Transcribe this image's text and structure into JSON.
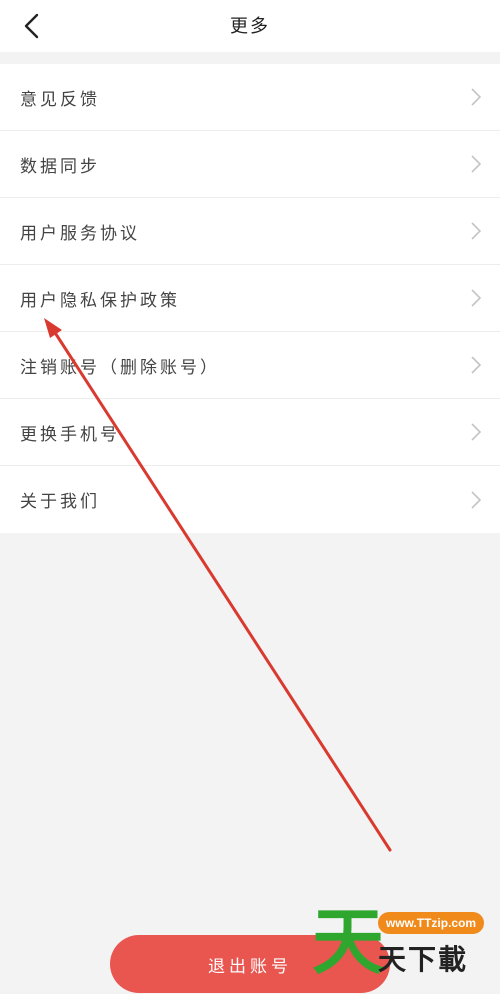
{
  "header": {
    "title": "更多"
  },
  "menu": {
    "items": [
      {
        "label": "意见反馈"
      },
      {
        "label": "数据同步"
      },
      {
        "label": "用户服务协议"
      },
      {
        "label": "用户隐私保护政策"
      },
      {
        "label": "注销账号（删除账号）"
      },
      {
        "label": "更换手机号"
      },
      {
        "label": "关于我们"
      }
    ]
  },
  "footer": {
    "logout_label": "退出账号"
  },
  "watermark": {
    "big": "天",
    "url": "www.TTzip.com",
    "text": "天下載"
  },
  "colors": {
    "accent": "#e9554f",
    "annotation": "#d93a2f",
    "watermark_green": "#2fa72f",
    "watermark_orange": "#f08a1a"
  },
  "icons": {
    "back": "chevron-left-icon",
    "row": "chevron-right-icon"
  }
}
